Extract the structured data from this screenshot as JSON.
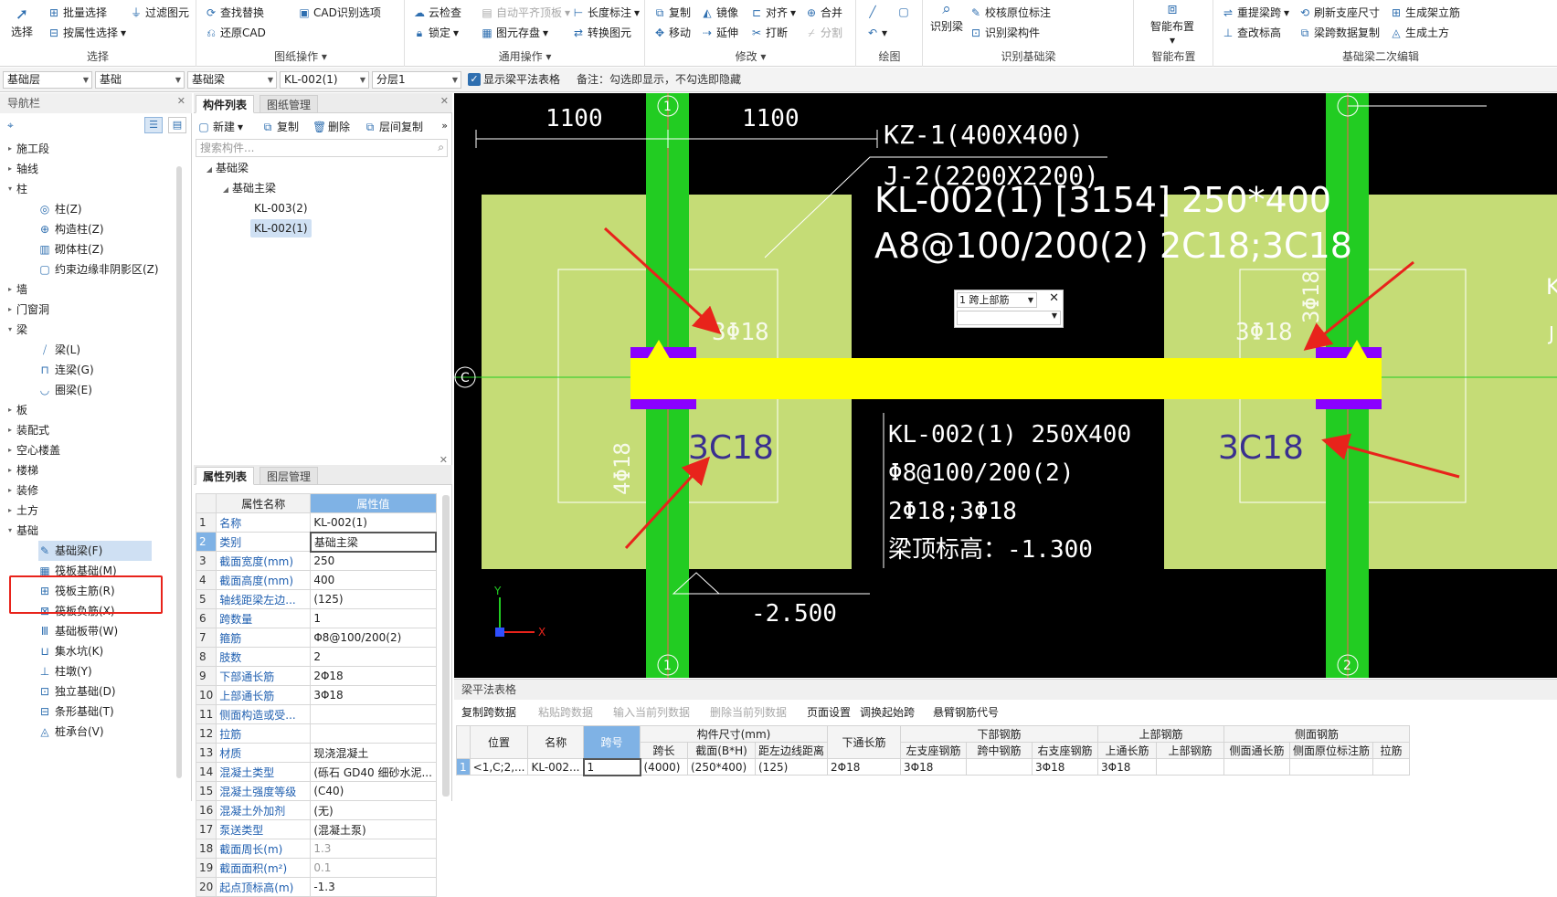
{
  "ribbon": {
    "select": {
      "big": "选择",
      "batch": "批量选择",
      "by_attr": "按属性选择",
      "filter": "过滤图元",
      "label": "选择"
    },
    "drawing_ops": {
      "find_replace": "查找替换",
      "cad_options": "CAD识别选项",
      "restore_cad": "还原CAD",
      "label": "图纸操作"
    },
    "general_ops": {
      "cloud_check": "云检查",
      "auto_flat": "自动平齐顶板",
      "length_mark": "长度标注",
      "lock": "锁定",
      "elem_save": "图元存盘",
      "convert_elem": "转换图元",
      "label": "通用操作"
    },
    "modify": {
      "copy": "复制",
      "mirror": "镜像",
      "align": "对齐",
      "merge": "合并",
      "move": "移动",
      "extend": "延伸",
      "break": "打断",
      "split": "分割",
      "label": "修改"
    },
    "draw": {
      "label": "绘图"
    },
    "identify_beam": {
      "big": "识别梁",
      "check_marks": "校核原位标注",
      "identify_parts": "识别梁构件",
      "label": "识别基础梁"
    },
    "smart_layout": {
      "big": "智能布置",
      "label": "智能布置"
    },
    "secondary_edit": {
      "reextract": "重提梁跨",
      "refresh_support": "刷新支座尺寸",
      "gen_stirrup": "生成架立筋",
      "view_elev": "查改标高",
      "span_copy": "梁跨数据复制",
      "gen_earth": "生成土方",
      "label": "基础梁二次编辑"
    }
  },
  "filter_bar": {
    "layer": "基础层",
    "category": "基础",
    "type": "基础梁",
    "element": "KL-002(1)",
    "sublayer": "分层1",
    "show_table_label": "显示梁平法表格",
    "note": "备注：勾选即显示，不勾选即隐藏"
  },
  "nav": {
    "title": "导航栏",
    "groups": [
      {
        "label": "施工段"
      },
      {
        "label": "轴线"
      },
      {
        "label": "柱"
      },
      {
        "label": "墙"
      },
      {
        "label": "门窗洞"
      },
      {
        "label": "梁"
      },
      {
        "label": "板"
      },
      {
        "label": "装配式"
      },
      {
        "label": "空心楼盖"
      },
      {
        "label": "楼梯"
      },
      {
        "label": "装修"
      },
      {
        "label": "土方"
      },
      {
        "label": "基础"
      }
    ],
    "column_items": [
      "柱(Z)",
      "构造柱(Z)",
      "砌体柱(Z)",
      "约束边缘非阴影区(Z)"
    ],
    "beam_items": [
      "梁(L)",
      "连梁(G)",
      "圈梁(E)"
    ],
    "foundation_items": [
      "基础梁(F)",
      "筏板基础(M)",
      "筏板主筋(R)",
      "筏板负筋(X)",
      "基础板带(W)",
      "集水坑(K)",
      "柱墩(Y)",
      "独立基础(D)",
      "条形基础(T)",
      "桩承台(V)"
    ]
  },
  "component_panel": {
    "tabs": [
      "构件列表",
      "图纸管理"
    ],
    "toolbar": {
      "new": "新建",
      "copy": "复制",
      "delete": "删除",
      "floor_copy": "层间复制"
    },
    "search_placeholder": "搜索构件...",
    "tree": {
      "root": "基础梁",
      "child": "基础主梁",
      "items": [
        "KL-003(2)",
        "KL-002(1)"
      ]
    }
  },
  "property_panel": {
    "tabs": [
      "属性列表",
      "图层管理"
    ],
    "header": {
      "name": "属性名称",
      "value": "属性值"
    },
    "rows": [
      {
        "no": "1",
        "name": "名称",
        "value": "KL-002(1)"
      },
      {
        "no": "2",
        "name": "类别",
        "value": "基础主梁"
      },
      {
        "no": "3",
        "name": "截面宽度(mm)",
        "value": "250"
      },
      {
        "no": "4",
        "name": "截面高度(mm)",
        "value": "400"
      },
      {
        "no": "5",
        "name": "轴线距梁左边...",
        "value": "(125)"
      },
      {
        "no": "6",
        "name": "跨数量",
        "value": "1"
      },
      {
        "no": "7",
        "name": "箍筋",
        "value": "Φ8@100/200(2)"
      },
      {
        "no": "8",
        "name": "肢数",
        "value": "2"
      },
      {
        "no": "9",
        "name": "下部通长筋",
        "value": "2Φ18"
      },
      {
        "no": "10",
        "name": "上部通长筋",
        "value": "3Φ18"
      },
      {
        "no": "11",
        "name": "侧面构造或受...",
        "value": ""
      },
      {
        "no": "12",
        "name": "拉筋",
        "value": ""
      },
      {
        "no": "13",
        "name": "材质",
        "value": "现浇混凝土"
      },
      {
        "no": "14",
        "name": "混凝土类型",
        "value": "(砾石 GD40 细砂水泥..."
      },
      {
        "no": "15",
        "name": "混凝土强度等级",
        "value": "(C40)"
      },
      {
        "no": "16",
        "name": "混凝土外加剂",
        "value": "(无)"
      },
      {
        "no": "17",
        "name": "泵送类型",
        "value": "(混凝土泵)"
      },
      {
        "no": "18",
        "name": "截面周长(m)",
        "value": "1.3"
      },
      {
        "no": "19",
        "name": "截面面积(m²)",
        "value": "0.1"
      },
      {
        "no": "20",
        "name": "起点顶标高(m)",
        "value": "-1.3"
      }
    ]
  },
  "cad": {
    "dim1": "1100",
    "dim2": "1100",
    "kz": "KZ-1(400X400)",
    "j2": "J-2(2200X2200)",
    "beam_title": "KL-002(1) [3154] 250*400",
    "beam_rebar": "A8@100/200(2) 2C18;3C18",
    "axis1": "1",
    "axis2": "2",
    "axisC": "C",
    "top_left": "3Φ18",
    "top_right": "3Φ18",
    "bot_left": "3C18",
    "bot_right": "3C18",
    "vert_left": "4Φ18",
    "vert_right": "3Φ18",
    "orig_line1": "KL-002(1) 250X400",
    "orig_line2": "Φ8@100/200(2)",
    "orig_line3": "2Φ18;3Φ18",
    "orig_line4": "梁顶标高：-1.300",
    "elev": "-2.500",
    "popup_select": "1 跨上部筋",
    "axis_y": "Y",
    "axis_x": "X",
    "edge_k": "K",
    "edge_j": "J"
  },
  "bottom_panel": {
    "title": "梁平法表格",
    "toolbar": [
      "复制跨数据",
      "粘贴跨数据",
      "输入当前列数据",
      "删除当前列数据",
      "页面设置",
      "调换起始跨",
      "悬臂钢筋代号"
    ],
    "toolbar_disabled": [
      false,
      true,
      true,
      true,
      false,
      false,
      false
    ],
    "headers_top": [
      "位置",
      "名称",
      "跨号",
      "构件尺寸(mm)",
      "下通长筋",
      "下部钢筋",
      "上部钢筋",
      "侧面钢筋"
    ],
    "headers_sub": [
      "跨长",
      "截面(B*H)",
      "距左边线距离",
      "左支座钢筋",
      "跨中钢筋",
      "右支座钢筋",
      "上通长筋",
      "上部钢筋",
      "侧面通长筋",
      "侧面原位标注筋",
      "拉筋"
    ],
    "row": {
      "idx": "1",
      "pos": "<1,C;2,...",
      "name": "KL-002...",
      "span": "1",
      "len": "(4000)",
      "sec": "(250*400)",
      "dist": "(125)",
      "bot_through": "2Φ18",
      "left_sup": "3Φ18",
      "mid": "",
      "right_sup": "3Φ18",
      "top_through": "3Φ18",
      "top_bar": "",
      "side_through": "",
      "side_orig": "",
      "tie": ""
    }
  },
  "colors": {
    "accent": "#2f6fb0",
    "header_blue": "#7fb2e5",
    "beam_yellow": "#ffff00",
    "column_green": "#22cc22",
    "footing": "#c5dc76",
    "support_purple": "#8a00ff",
    "arrow_red": "#e8231b",
    "text_navy": "#3a2f8f"
  }
}
